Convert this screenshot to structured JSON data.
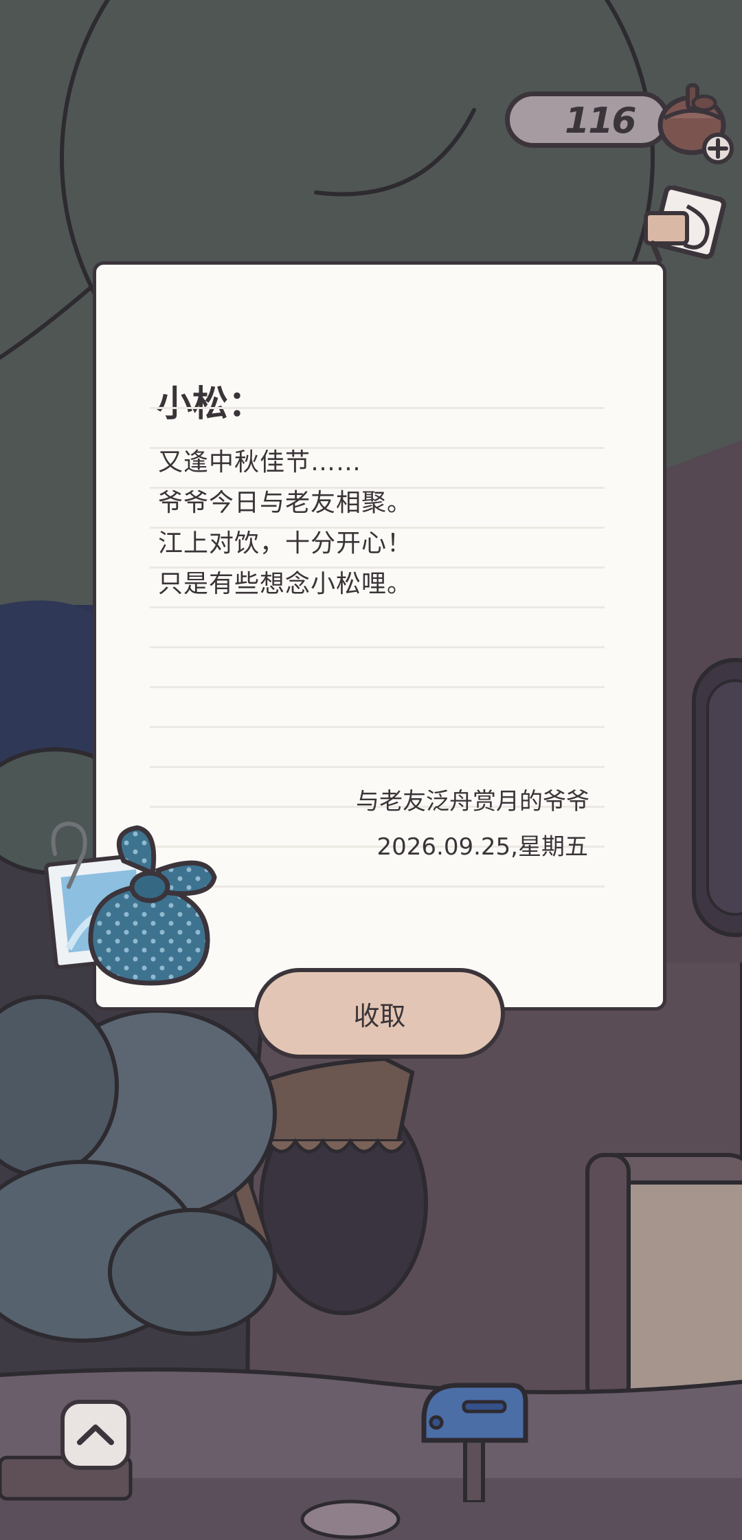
{
  "hud": {
    "acorn_count": "116",
    "acorn_icon": "acorn-icon",
    "add_icon": "plus-icon",
    "letter_icon": "letter-icon"
  },
  "letter": {
    "greeting": "小松：",
    "lines": [
      "又逢中秋佳节……",
      "爷爷今日与老友相聚。",
      "江上对饮，十分开心！",
      "只是有些想念小松哩。"
    ],
    "signature": "与老友泛舟赏月的爷爷",
    "date": "2026.09.25,星期五",
    "attachment_icon": "gift-bundle-icon"
  },
  "buttons": {
    "collect_label": "收取",
    "expand_icon": "chevron-up-icon"
  },
  "colors": {
    "outline": "#3b343b",
    "paper": "#fcfaf6",
    "button": "#e2c5b4",
    "night_sky": "#2c3452",
    "canopy": "#4f5654"
  }
}
